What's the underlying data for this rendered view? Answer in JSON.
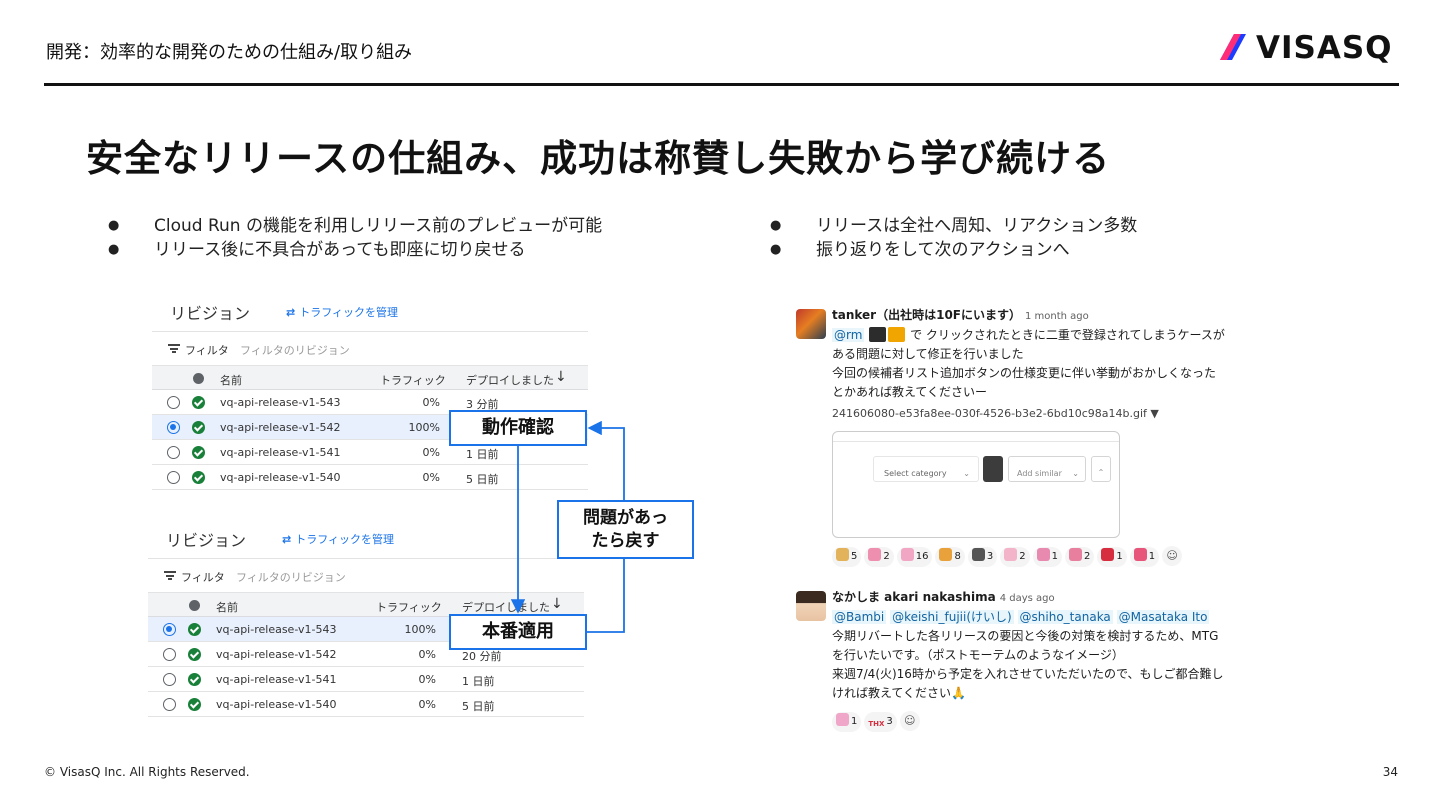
{
  "header": {
    "section_title": "開発：効率的な開発のための仕組み/取り組み",
    "logo_text": "VISASQ",
    "logo_colors": [
      "#1e3cff",
      "#ff2d78"
    ]
  },
  "slide": {
    "title": "安全なリリースの仕組み、成功は称賛し失敗から学び続ける",
    "bullets_left": [
      "Cloud Run の機能を利用しリリース前のプレビューが可能",
      "リリース後に不具合があっても即座に切り戻せる"
    ],
    "bullets_right": [
      "リリースは全社へ周知、リアクション多数",
      "振り返りをして次のアクションへ"
    ]
  },
  "revision_panels": [
    {
      "title": "リビジョン",
      "traffic_link": "トラフィックを管理",
      "filter_label": "フィルタ",
      "filter_placeholder": "フィルタのリビジョン",
      "columns": [
        "名前",
        "トラフィック",
        "デプロイしました"
      ],
      "sort_icon": "arrow-down-icon",
      "rows": [
        {
          "name": "vq-api-release-v1-543",
          "traffic": "0%",
          "deployed": "3 分前",
          "selected": false
        },
        {
          "name": "vq-api-release-v1-542",
          "traffic": "100%",
          "deployed": "",
          "selected": true
        },
        {
          "name": "vq-api-release-v1-541",
          "traffic": "0%",
          "deployed": "1 日前",
          "selected": false
        },
        {
          "name": "vq-api-release-v1-540",
          "traffic": "0%",
          "deployed": "5 日前",
          "selected": false
        }
      ]
    },
    {
      "title": "リビジョン",
      "traffic_link": "トラフィックを管理",
      "filter_label": "フィルタ",
      "filter_placeholder": "フィルタのリビジョン",
      "columns": [
        "名前",
        "トラフィック",
        "デプロイしました"
      ],
      "sort_icon": "arrow-down-icon",
      "rows": [
        {
          "name": "vq-api-release-v1-543",
          "traffic": "100%",
          "deployed": "",
          "selected": true
        },
        {
          "name": "vq-api-release-v1-542",
          "traffic": "0%",
          "deployed": "20 分前",
          "selected": false
        },
        {
          "name": "vq-api-release-v1-541",
          "traffic": "0%",
          "deployed": "1 日前",
          "selected": false
        },
        {
          "name": "vq-api-release-v1-540",
          "traffic": "0%",
          "deployed": "5 日前",
          "selected": false
        }
      ]
    }
  ],
  "callouts": {
    "check": "動作確認",
    "rollback_line1": "問題があっ",
    "rollback_line2": "たら戻す",
    "production": "本番適用",
    "color": "#1a73e8"
  },
  "messages": [
    {
      "author": "tanker（出社時は10Fにいます）",
      "time": "1 month ago",
      "mention": "@rm",
      "line1_rest": "で クリックされたときに二重で登録されてしまうケースが",
      "line2": "ある問題に対して修正を行いました",
      "line3": "今回の候補者リスト追加ボタンの仕様変更に伴い挙動がおかしくなった",
      "line4": "とかあれば教えてくださいー",
      "file_name": "241606080-e53fa8ee-030f-4526-b3e2-6bd10c98a14b.gif",
      "file_caret": "▼",
      "preview": {
        "select_label": "Select category",
        "add_label": "Add similar"
      },
      "reactions": [
        {
          "icon": "eyes-emoji-icon",
          "count": "5",
          "color": "#e2b35a"
        },
        {
          "icon": "stamp-emoji-icon",
          "count": "2",
          "color": "#ef8fb0"
        },
        {
          "icon": "stamp-emoji-icon",
          "count": "16",
          "color": "#f1a7c4"
        },
        {
          "icon": "party-popper-icon",
          "count": "8",
          "color": "#e9a23b"
        },
        {
          "icon": "god-emoji-icon",
          "count": "3",
          "color": "#555555"
        },
        {
          "icon": "stamp-emoji-icon",
          "count": "2",
          "color": "#f3b3c9"
        },
        {
          "icon": "stamp-emoji-icon",
          "count": "1",
          "color": "#e88ab0"
        },
        {
          "icon": "stamp-emoji-icon",
          "count": "2",
          "color": "#e87f9f"
        },
        {
          "icon": "red-heart-icon",
          "count": "1",
          "color": "#d62d3f"
        },
        {
          "icon": "pink-heart-icon",
          "count": "1",
          "color": "#e8557a"
        }
      ]
    },
    {
      "author": "なかしま akari nakashima",
      "time": "4 days ago",
      "mentions": [
        "@Bambi",
        "@keishi_fujii(けいし)",
        "@shiho_tanaka",
        "@Masataka Ito"
      ],
      "line2": "今期リバートした各リリースの要因と今後の対策を検討するため、MTG",
      "line3": "を行いたいです。（ポストモーテムのようなイメージ）",
      "line4": "来週7/4(火)16時から予定を入れさせていただいたので、もしご都合難し",
      "line5": "ければ教えてください🙏",
      "reactions": [
        {
          "icon": "stamp-emoji-icon",
          "count": "1",
          "color": "#f0a6c8"
        },
        {
          "icon": "thx-emoji-icon",
          "count": "3",
          "label": "THX",
          "color": "#d62d3f"
        }
      ]
    }
  ],
  "footer": {
    "copyright": "© VisasQ Inc. All Rights Reserved.",
    "page_number": "34"
  }
}
